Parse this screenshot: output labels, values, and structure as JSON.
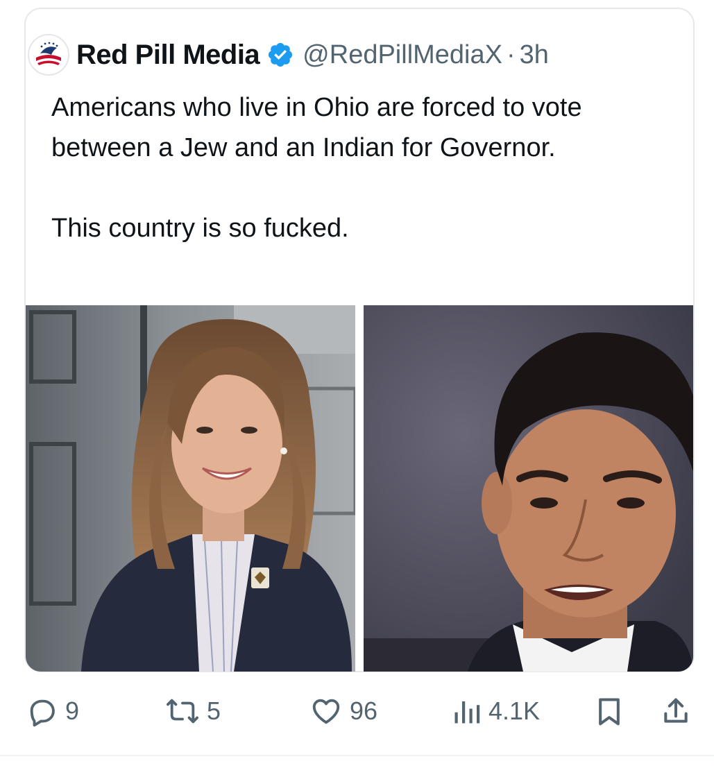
{
  "tweet": {
    "author_name": "Red Pill Media",
    "handle": "@RedPillMediaX",
    "separator": "·",
    "time": "3h",
    "verified": true,
    "text_lines": [
      "Americans who live in Ohio are forced to vote between a Jew and an Indian  for Governor.",
      "This country is so fucked."
    ],
    "images": [
      {
        "description": "portrait-woman-smiling"
      },
      {
        "description": "portrait-man-speaking"
      }
    ]
  },
  "actions": {
    "replies": "9",
    "reposts": "5",
    "likes": "96",
    "views": "4.1K"
  },
  "colors": {
    "text": "#0f1419",
    "muted": "#536471",
    "verified": "#1d9bf0",
    "border": "#e6e9ec"
  }
}
